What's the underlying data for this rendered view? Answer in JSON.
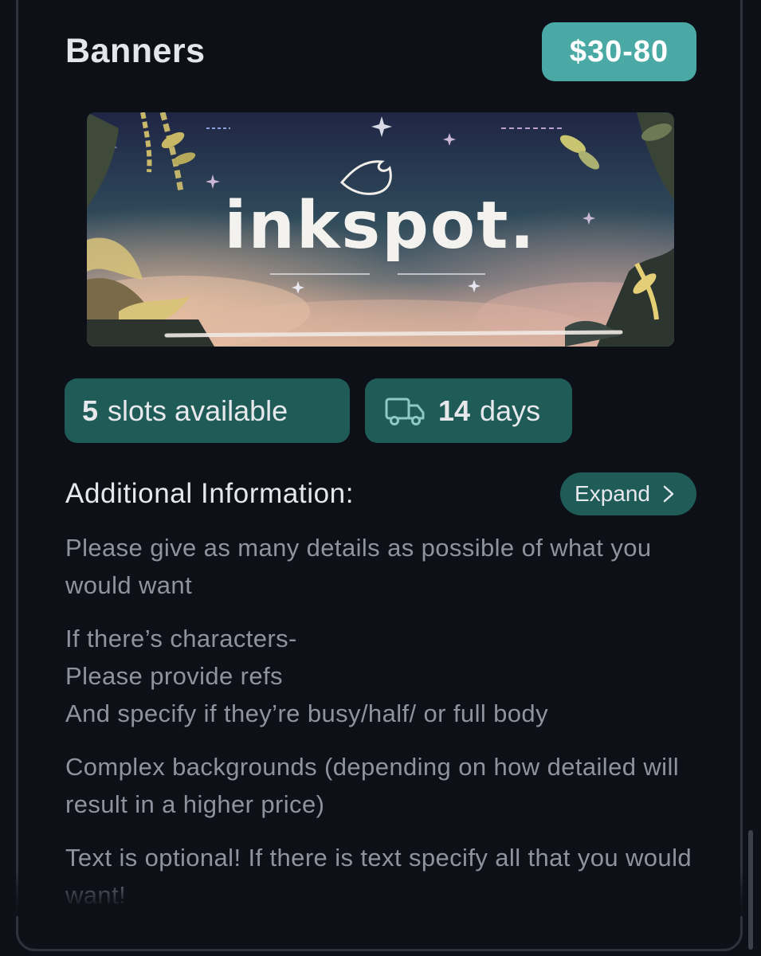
{
  "listing": {
    "title": "Banners",
    "price": "$30-80"
  },
  "banner_image": {
    "description_icon": "banner-artwork-image",
    "text": "inkspot."
  },
  "chips": {
    "slots_count": "5",
    "slots_label": "slots available",
    "days_count": "14",
    "days_label": "days",
    "delivery_icon": "truck-icon"
  },
  "additional": {
    "title": "Additional Information:",
    "expand_label": "Expand",
    "expand_icon": "chevron-right-icon",
    "paragraphs": [
      "Please give as many details as possible of what you would want",
      "If there’s characters-\nPlease provide refs\nAnd specify if they’re busy/half/ or full body",
      "Complex backgrounds (depending on how detailed will result in a higher price)",
      "Text is optional! If there is text specify all that you would want!"
    ]
  },
  "colors": {
    "background": "#0d1017",
    "accent": "#4aa9a5",
    "chip": "#1f5c58",
    "text_primary": "#e6e8ec",
    "text_secondary": "#8f939d"
  }
}
